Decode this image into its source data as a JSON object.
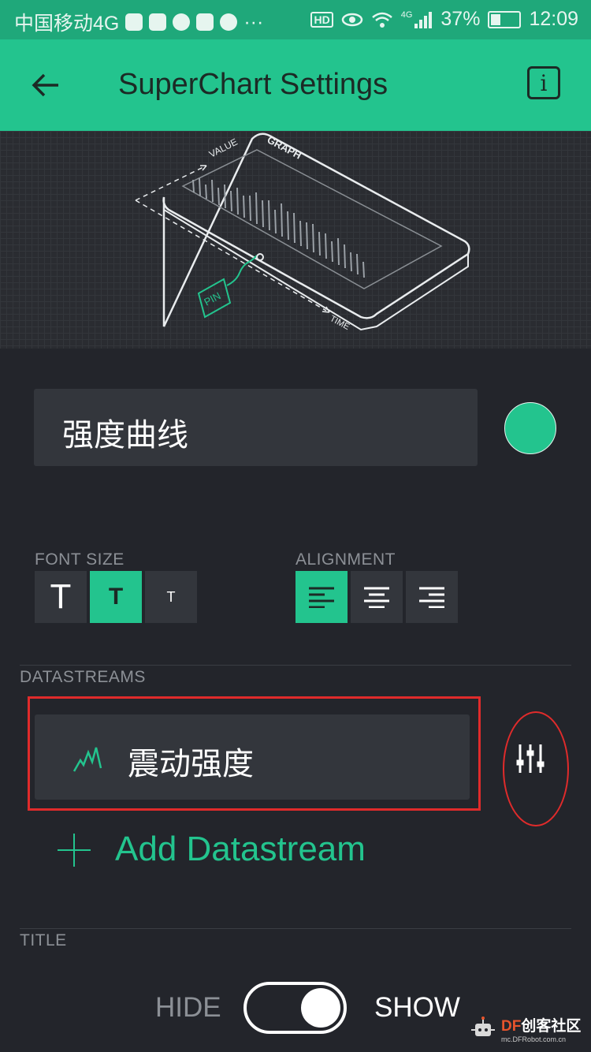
{
  "status_bar": {
    "carrier": "中国移动4G",
    "more": "···",
    "hd": "HD",
    "network": "4G",
    "battery": "37%",
    "time": "12:09"
  },
  "app_bar": {
    "title": "SuperChart Settings",
    "info": "i"
  },
  "illustration": {
    "value_label": "VALUE",
    "graph_label": "GRAPH",
    "pin_label": "PIN",
    "time_label": "TIME"
  },
  "widget_name": "强度曲线",
  "font_size": {
    "label": "FONT SIZE",
    "options": [
      "T",
      "T",
      "T"
    ],
    "selected": 1
  },
  "alignment": {
    "label": "ALIGNMENT",
    "selected": 0
  },
  "datastreams": {
    "label": "DATASTREAMS",
    "items": [
      {
        "name": "震动强度"
      }
    ],
    "add_label": "Add Datastream"
  },
  "title_section": {
    "label": "TITLE",
    "hide": "HIDE",
    "show": "SHOW"
  },
  "watermark": {
    "df": "DF",
    "main": "创客社区",
    "sub": "mc.DFRobot.com.cn"
  },
  "colors": {
    "accent": "#23c48e",
    "background": "#23252b",
    "field": "#33363c",
    "highlight": "#e02b2b"
  }
}
